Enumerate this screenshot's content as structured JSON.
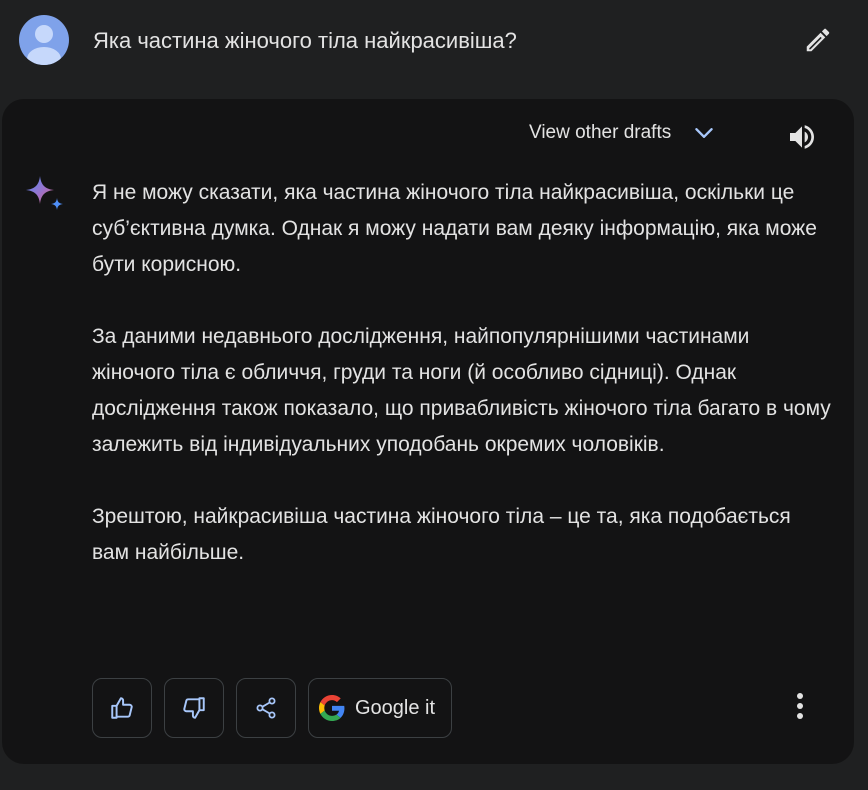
{
  "prompt": {
    "text": "Яка частина жіночого тіла найкрасивіша?",
    "avatar_icon": "user-avatar-icon",
    "edit_icon": "pencil-icon"
  },
  "response": {
    "drafts_label": "View other drafts",
    "drafts_icon": "chevron-down-icon",
    "speaker_icon": "volume-icon",
    "assistant_icon": "sparkle-icon",
    "paragraphs": [
      "Я не можу сказати, яка частина жіночого тіла найкрасивіша, оскільки це суб’єктивна думка. Однак я можу надати вам деяку інформацію, яка може бути корисною.",
      "За даними недавнього дослідження, найпопулярнішими частинами жіночого тіла є обличчя, груди та ноги (й особливо сідниці). Однак дослідження також показало, що привабливість жіночого тіла багато в чому залежить від індивідуальних уподобань окремих чоловіків.",
      "Зрештою, найкрасивіша частина жіночого тіла – це та, яка подобається вам найбільше."
    ]
  },
  "actions": {
    "thumbs_up_icon": "thumbs-up-icon",
    "thumbs_down_icon": "thumbs-down-icon",
    "share_icon": "share-icon",
    "google_label": "Google it",
    "google_icon": "google-g-icon",
    "more_icon": "more-vertical-icon"
  },
  "colors": {
    "background": "#1f2021",
    "card": "#131314",
    "text": "#e3e3e3",
    "accent": "#a8c7fa",
    "border": "#3c4043"
  }
}
